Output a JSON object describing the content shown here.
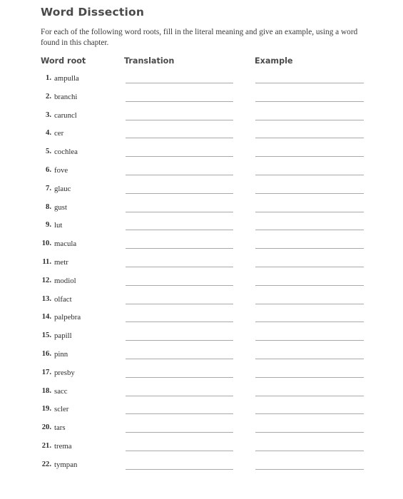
{
  "worksheet": {
    "title": "Word Dissection",
    "instructions": "For each of the following word roots, fill in the literal meaning and give an example, using a word found in this chapter.",
    "columns": {
      "word_root": "Word root",
      "translation": "Translation",
      "example": "Example"
    },
    "rows": [
      {
        "num": "1.",
        "root": "ampulla",
        "translation": "",
        "example": ""
      },
      {
        "num": "2.",
        "root": "branchi",
        "translation": "",
        "example": ""
      },
      {
        "num": "3.",
        "root": "caruncl",
        "translation": "",
        "example": ""
      },
      {
        "num": "4.",
        "root": "cer",
        "translation": "",
        "example": ""
      },
      {
        "num": "5.",
        "root": "cochlea",
        "translation": "",
        "example": ""
      },
      {
        "num": "6.",
        "root": "fove",
        "translation": "",
        "example": ""
      },
      {
        "num": "7.",
        "root": "glauc",
        "translation": "",
        "example": ""
      },
      {
        "num": "8.",
        "root": "gust",
        "translation": "",
        "example": ""
      },
      {
        "num": "9.",
        "root": "lut",
        "translation": "",
        "example": ""
      },
      {
        "num": "10.",
        "root": "macula",
        "translation": "",
        "example": ""
      },
      {
        "num": "11.",
        "root": "metr",
        "translation": "",
        "example": ""
      },
      {
        "num": "12.",
        "root": "modiol",
        "translation": "",
        "example": ""
      },
      {
        "num": "13.",
        "root": "olfact",
        "translation": "",
        "example": ""
      },
      {
        "num": "14.",
        "root": "palpebra",
        "translation": "",
        "example": ""
      },
      {
        "num": "15.",
        "root": "papill",
        "translation": "",
        "example": ""
      },
      {
        "num": "16.",
        "root": "pinn",
        "translation": "",
        "example": ""
      },
      {
        "num": "17.",
        "root": "presby",
        "translation": "",
        "example": ""
      },
      {
        "num": "18.",
        "root": "sacc",
        "translation": "",
        "example": ""
      },
      {
        "num": "19.",
        "root": "scler",
        "translation": "",
        "example": ""
      },
      {
        "num": "20.",
        "root": "tars",
        "translation": "",
        "example": ""
      },
      {
        "num": "21.",
        "root": "trema",
        "translation": "",
        "example": ""
      },
      {
        "num": "22.",
        "root": "tympan",
        "translation": "",
        "example": ""
      }
    ]
  },
  "colors": {
    "heading_text": "#4a4a4a",
    "body_text": "#2e2e2e",
    "rule_line": "#a9a9a9",
    "page_background": "#ffffff"
  }
}
